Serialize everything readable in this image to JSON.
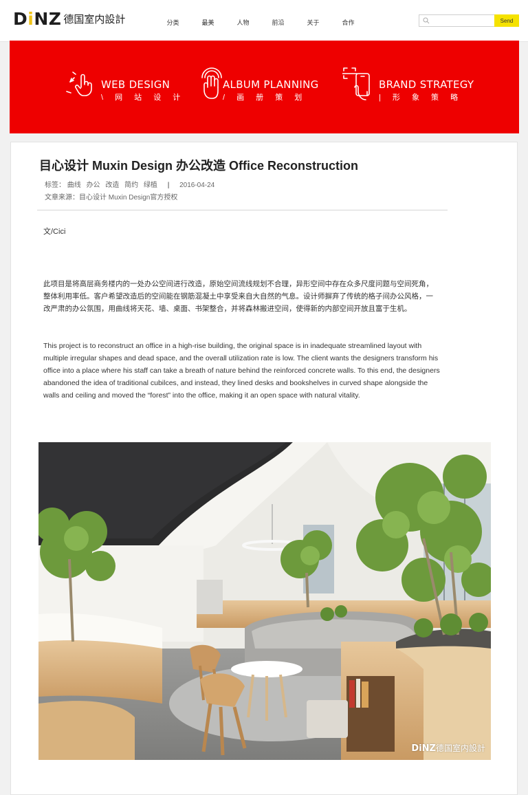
{
  "header": {
    "logo_mark_pre": "D",
    "logo_mark_i": "i",
    "logo_mark_post": "NZ",
    "logo_text": "德国室内設計",
    "nav": [
      "分类",
      "最美",
      "人物",
      "前沿",
      "关于",
      "合作"
    ],
    "search_placeholder": "",
    "search_button": "Send"
  },
  "banner": {
    "items": [
      {
        "title": "WEB DESIGN",
        "subtitle": "\\ 网 站 设 计",
        "icon": "touch-swipe-icon"
      },
      {
        "title": "ALBUM PLANNING",
        "subtitle": "/ 画 册 策 划",
        "icon": "multi-touch-icon"
      },
      {
        "title": "BRAND STRATEGY",
        "subtitle": "| 形 象 策 略",
        "icon": "phone-scan-icon"
      }
    ]
  },
  "article": {
    "title": "目心设计 Muxin Design 办公改造 Office Reconstruction",
    "tags_label": "标签：",
    "tags": [
      "曲线",
      "办公",
      "改造",
      "简约",
      "绿植"
    ],
    "separator": "|",
    "date": "2016-04-24",
    "source": "文章来源：目心设计 Muxin Design官方授权",
    "author": "文/Cici",
    "paragraph_cn": "此项目是将高层商务楼内的一处办公空间进行改造，原始空间流线规划不合理，异形空间中存在众多尺度问题与空间死角，整体利用率低。客户希望改造后的空间能在钢筋混凝土中享受来自大自然的气息。设计师摒弃了传统的格子间办公风格，一改严肃的办公氛围，用曲线将天花、墙、桌面、书架整合，并将森林搬进空间，使得新的内部空间开放且富于生机。",
    "paragraph_en": "This project is to reconstruct an office in a high-rise building, the original space is in inadequate streamlined layout with multiple irregular shapes and dead space, and the overall utilization rate is low. The client wants the designers transform his office into a place where his staff can take a breath of nature behind the reinforced concrete walls. To this end, the designers abandoned the idea of traditional cubilces, and instead, they lined desks and bookshelves in curved shape alongside the walls and ceiling and moved the “forest” into the office, making it an open space with natural vitality.",
    "watermark_mark": "DiNZ",
    "watermark_text": "德国室内設計"
  },
  "colors": {
    "banner_red": "#ee0000",
    "search_button_yellow": "#f5e200",
    "logo_accent": "#f0c419"
  }
}
